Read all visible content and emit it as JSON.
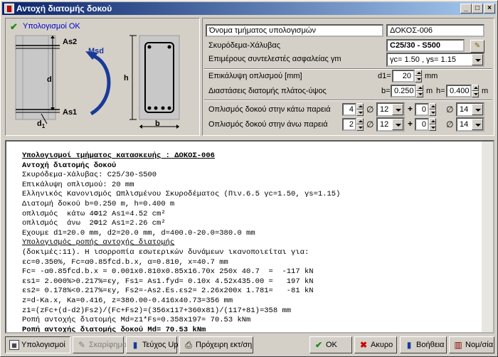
{
  "window": {
    "title": "Αντοχή διατομής δοκού"
  },
  "status": {
    "ok_text": "Υπολογισμοί ΟΚ"
  },
  "diagram": {
    "as2": "As2",
    "as1": "As1",
    "msd": "Msd",
    "d": "d",
    "d1": "d",
    "d1_sub": "1",
    "h": "h",
    "b": "b"
  },
  "form": {
    "name_label": "Όνομα τμήματος υπολογισμών",
    "name_value": "ΔΟΚΟΣ-006",
    "material_label": "Σκυρόδεμα-Χάλυβας",
    "material_value": "C25/30 - S500",
    "safety_label": "Επιμέρους συντελεστές ασφαλείας γm",
    "safety_value": "γc= 1.50 , γs= 1.15",
    "cover_label": "Επικάλυψη οπλισμού [mm]",
    "cover_prefix": "d1=",
    "cover_value": "20",
    "cover_unit": "mm",
    "dims_label": "Διαστάσεις διατομής πλάτος-ύψος",
    "b_prefix": "b=",
    "b_value": "0.250",
    "b_unit": "m",
    "h_prefix": "h=",
    "h_value": "0.400",
    "h_unit": "m",
    "bottom_label": "Οπλισμός δοκού στην κάτω παρειά",
    "bottom_n1": "4",
    "bottom_d1": "12",
    "bottom_n2": "0",
    "bottom_d2": "14",
    "top_label": "Οπλισμός δοκού στην άνω παρειά",
    "top_n1": "2",
    "top_d1": "12",
    "top_n2": "0",
    "top_d2": "14",
    "phi": "∅",
    "plus": "+"
  },
  "report": {
    "lines": [
      "Υπολογισμοί τμήματος κατασκευής : ΔΟΚΟΣ-006",
      "Αντοχή διατομής δοκού",
      "Σκυρόδεμα-Χάλυβας: C25/30-S500",
      "Επικάλυψη οπλισμού: 20 mm",
      "Ελληνικός Κανονισμός Ωπλισμένου Σκυροδέματος (Πιν.6.5 γc=1.50, γs=1.15)",
      "Διατομή δοκού b=0.250 m, h=0.400 m",
      "οπλισμός  κάτω 4Φ12 As1=4.52 cm²",
      "οπλισμός  άνω  2Φ12 As1=2.26 cm²",
      "Εχουμε d1=20.0 mm, d2=20.0 mm, d=400.0-20.0=380.0 mm",
      "Υπολογισμός ροπής αντοχής διατομής",
      "(δοκιμές:11). Η ισορροπία εσωτερικών δυνάμεων ικανοποιείται για:",
      "εc=0.350%, Fc=α0.85fcd.b.x, α=0.810, x=40.7 mm",
      "Fc= -α0.85fcd.b.x = 0.001x0.810x0.85x16.70x 250x 40.7  =  -117 kN",
      "εs1= 2.000%>0.217%=εy, Fs1= As1.fyd= 0.10x 4.52x435.00 =   197 kN",
      "εs2= 0.178%<0.217%=εy, Fs2=-As2.Es.εs2= 2.26x200x 1.781=   -81 kN",
      "z=d-Ka.x, Ka=0.416, z=380.00-0.416x40.73=356 mm",
      "z1=(zFc+(d-d2)Fs2)/(Fc+Fs2)=(356x117+360x81)/(117+81)=358 mm",
      "Ροπή αντοχής διατομής Md=z1*Fs=0.358x197= 70.53 kNm",
      "Ροπή αντοχής διατομής δοκού Md= 70.53 kNm"
    ]
  },
  "buttons": {
    "calc": "Υπολογισμοί",
    "sketch": "Σκαρίφημα",
    "binder": "Τεύχος Up",
    "draft": "Πρόχειρη εκτ/ση",
    "ok": "OK",
    "cancel": "Ακυρο",
    "help": "Βοήθεια",
    "reg": "Νομ/σία"
  }
}
